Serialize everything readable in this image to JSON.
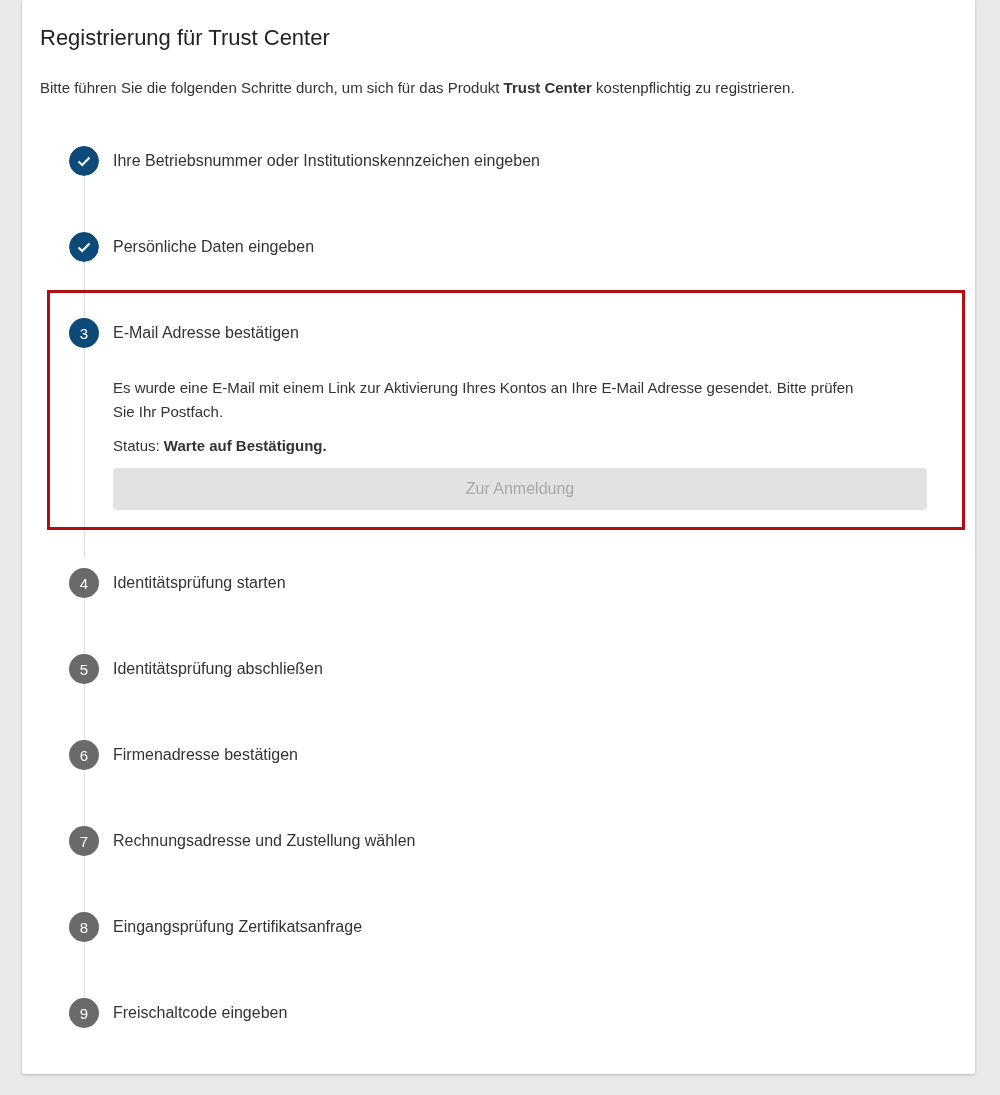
{
  "title": "Registrierung für Trust Center",
  "intro": "Bitte führen Sie die folgenden Schritte durch, um sich für das Produkt **Trust Center** kostenpflichtig zu registrieren.",
  "steps": [
    {
      "label": "Ihre Betriebsnummer oder Institutionskennzeichen eingeben",
      "completed": true,
      "highlighted": false
    },
    {
      "label": "Persönliche Daten eingeben",
      "completed": true,
      "highlighted": false
    },
    {
      "number": "3",
      "label": "E-Mail Adresse bestätigen",
      "completed": false,
      "current": true,
      "highlighted": true,
      "description": "Es wurde eine E-Mail mit einem Link zur Aktivierung Ihres Kontos an Ihre E-Mail Adresse gesendet. Bitte prüfen Sie Ihr Postfach.",
      "status_text": "Status: **Warte auf Bestätigung.**",
      "button": {
        "label": "Zur Anmeldung",
        "disabled": true
      }
    },
    {
      "number": "4",
      "label": "Identitätsprüfung starten",
      "completed": false,
      "current": false,
      "highlighted": false
    },
    {
      "number": "5",
      "label": "Identitätsprüfung abschließen",
      "completed": false,
      "current": false,
      "highlighted": false
    },
    {
      "number": "6",
      "label": "Firmenadresse bestätigen",
      "completed": false,
      "current": false,
      "highlighted": false
    },
    {
      "number": "7",
      "label": "Rechnungsadresse und Zustellung wählen",
      "completed": false,
      "current": false,
      "highlighted": false
    },
    {
      "number": "8",
      "label": "Eingangsprüfung Zertifikatsanfrage",
      "completed": false,
      "current": false,
      "highlighted": false
    },
    {
      "number": "9",
      "label": "Freischaltcode eingeben",
      "completed": false,
      "current": false,
      "highlighted": false
    }
  ]
}
